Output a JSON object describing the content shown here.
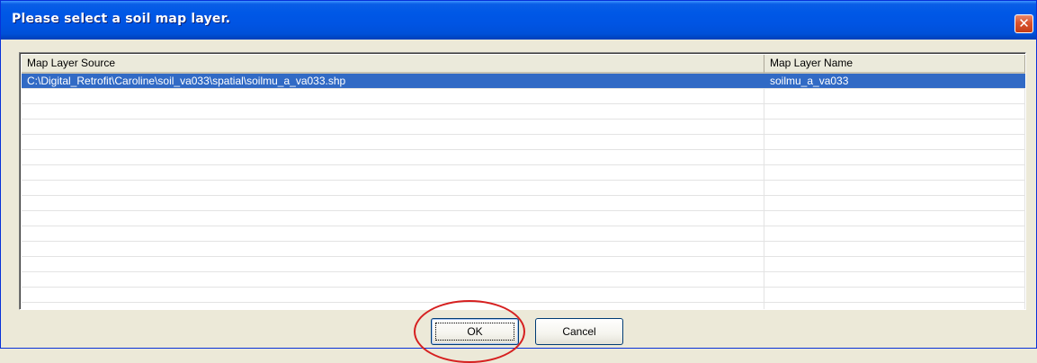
{
  "window": {
    "title": "Please select a soil map layer.",
    "close_glyph": "✕"
  },
  "list": {
    "columns": [
      "Map Layer Source",
      "Map Layer Name"
    ],
    "rows": [
      {
        "source": "C:\\Digital_Retrofit\\Caroline\\soil_va033\\spatial\\soilmu_a_va033.shp",
        "name": "soilmu_a_va033",
        "selected": true
      }
    ],
    "empty_row_count": 18
  },
  "buttons": {
    "ok_label": "OK",
    "cancel_label": "Cancel"
  },
  "colors": {
    "titlebar": "#0054e3",
    "selection": "#316ac5",
    "annotation_circle": "#d62020"
  },
  "icons": {
    "close": "close-icon"
  }
}
